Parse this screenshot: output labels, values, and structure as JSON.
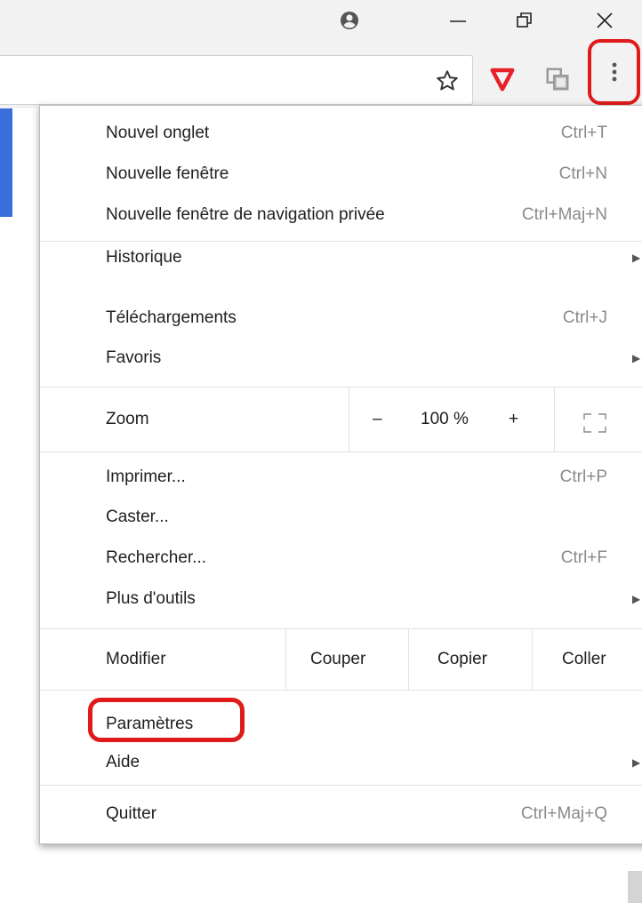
{
  "window": {
    "account_icon": "account-circle-icon",
    "minimize_icon": "minimize-icon",
    "maximize_icon": "restore-icon",
    "close_icon": "close-icon"
  },
  "toolbar": {
    "bookmark_icon": "star-icon",
    "extension1_icon": "shield-extension-icon",
    "extension2_icon": "copy-extension-icon",
    "menu_icon": "three-dots-menu-icon",
    "accent_red": "#e01a1a"
  },
  "menu": {
    "new_tab": {
      "label": "Nouvel onglet",
      "shortcut": "Ctrl+T"
    },
    "new_window": {
      "label": "Nouvelle fenêtre",
      "shortcut": "Ctrl+N"
    },
    "new_private_window": {
      "label": "Nouvelle fenêtre de navigation privée",
      "shortcut": "Ctrl+Maj+N"
    },
    "history": {
      "label": "Historique"
    },
    "downloads": {
      "label": "Téléchargements",
      "shortcut": "Ctrl+J"
    },
    "bookmarks": {
      "label": "Favoris"
    },
    "zoom": {
      "label": "Zoom",
      "minus": "–",
      "value": "100 %",
      "plus": "+",
      "fullscreen_icon": "fullscreen-icon"
    },
    "print": {
      "label": "Imprimer...",
      "shortcut": "Ctrl+P"
    },
    "cast": {
      "label": "Caster..."
    },
    "find": {
      "label": "Rechercher...",
      "shortcut": "Ctrl+F"
    },
    "more_tools": {
      "label": "Plus d'outils"
    },
    "edit": {
      "label": "Modifier",
      "cut": "Couper",
      "copy": "Copier",
      "paste": "Coller"
    },
    "settings": {
      "label": "Paramètres"
    },
    "help": {
      "label": "Aide"
    },
    "quit": {
      "label": "Quitter",
      "shortcut": "Ctrl+Maj+Q"
    }
  }
}
